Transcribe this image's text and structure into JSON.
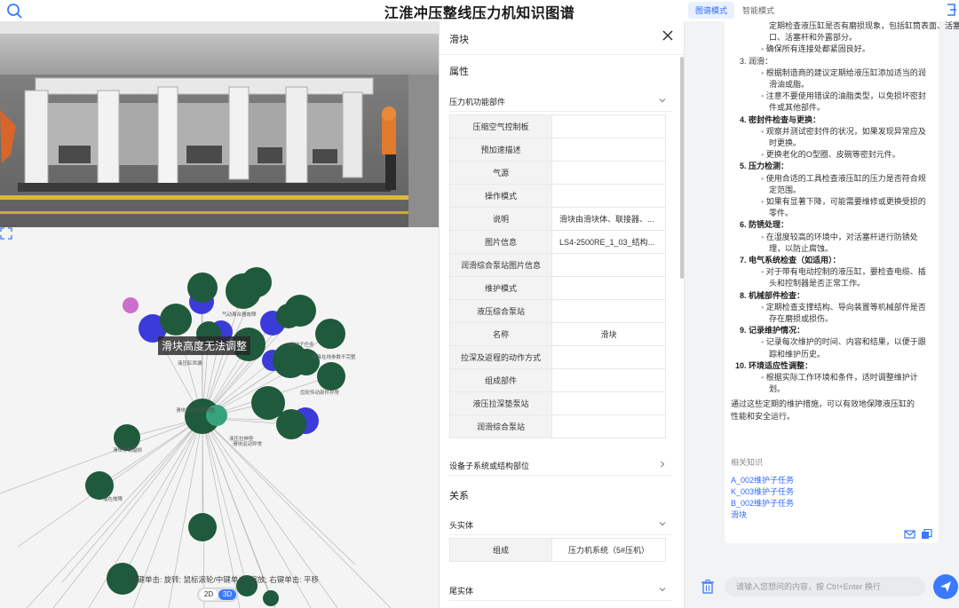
{
  "header": {
    "title": "江淮冲压整线压力机知识图谱",
    "modes": [
      "图谱模式",
      "智能模式"
    ]
  },
  "graph": {
    "tooltip": "滑块高度无法调整",
    "hint": "左键单击: 旋转; 鼠标滚轮/中键单击: 缩放; 右键单击: 平移",
    "view_toggle": [
      "2D",
      "3D"
    ],
    "node_labels": [
      "气动离合器故障",
      "滑块高度无法调整",
      "滑块运动异常",
      "液压缸泄漏",
      "维护子任务",
      "模具在线参数不完整",
      "齿轮传动部件异常",
      "液压拉伸垫",
      "滑块导轨磨损",
      "潜在故障"
    ]
  },
  "panel": {
    "title": "滑块",
    "attributes_title": "属性",
    "group_functional": "压力机功能部件",
    "rows": [
      {
        "k": "压缩空气控制板",
        "v": ""
      },
      {
        "k": "预加速描述",
        "v": ""
      },
      {
        "k": "气源",
        "v": ""
      },
      {
        "k": "操作模式",
        "v": ""
      },
      {
        "k": "说明",
        "v": "滑块由滑块体、联接器、..."
      },
      {
        "k": "图片信息",
        "v": "LS4-2500RE_1_03_结构..."
      },
      {
        "k": "润滑综合泵站图片信息",
        "v": ""
      },
      {
        "k": "维护模式",
        "v": ""
      },
      {
        "k": "液压综合泵站",
        "v": ""
      },
      {
        "k": "名称",
        "v": "滑块"
      },
      {
        "k": "拉深及返程的动作方式",
        "v": ""
      },
      {
        "k": "组成部件",
        "v": ""
      },
      {
        "k": "液压拉深垫泵站",
        "v": ""
      },
      {
        "k": "润滑综合泵站",
        "v": ""
      }
    ],
    "group_subsystem": "设备子系统或结构部位",
    "relations_title": "关系",
    "group_head": "头实体",
    "head_row": {
      "k": "组成",
      "v": "压力机系统（5#压机）"
    },
    "group_tail": "尾实体"
  },
  "chat": {
    "lines": [
      {
        "t": "定期检查液压缸是否有磨损现象，包括缸筒表面、活塞",
        "cls": "",
        "x": 50
      },
      {
        "t": "口、活塞杆和外露部分。",
        "cls": "",
        "x": 50
      },
      {
        "t": "◦ 确保所有连接处都紧固良好。",
        "cls": "",
        "x": 41
      },
      {
        "t": "3. 润滑：",
        "cls": "",
        "x": 17
      },
      {
        "t": "◦ 根据制造商的建议定期给液压缸添加适当的润",
        "cls": "",
        "x": 41
      },
      {
        "t": "滑油或脂。",
        "cls": "",
        "x": 50
      },
      {
        "t": "◦ 注意不要使用错误的油脂类型，以免损坏密封",
        "cls": "",
        "x": 41
      },
      {
        "t": "件或其他部件。",
        "cls": "",
        "x": 50
      },
      {
        "t": "4. 密封件检查与更换：",
        "cls": "b",
        "x": 17
      },
      {
        "t": "◦ 观察并测试密封件的状况，如果发现异常应及",
        "cls": "",
        "x": 41
      },
      {
        "t": "时更换。",
        "cls": "",
        "x": 50
      },
      {
        "t": "◦ 更换老化的O型圈、皮碗等密封元件。",
        "cls": "",
        "x": 41
      },
      {
        "t": "5. 压力检测：",
        "cls": "b",
        "x": 17
      },
      {
        "t": "◦ 使用合适的工具检查液压缸的压力是否符合规",
        "cls": "",
        "x": 41
      },
      {
        "t": "定范围。",
        "cls": "",
        "x": 50
      },
      {
        "t": "◦ 如果有显著下降，可能需要维修或更换受损的",
        "cls": "",
        "x": 41
      },
      {
        "t": "零件。",
        "cls": "",
        "x": 50
      },
      {
        "t": "6. 防锈处理：",
        "cls": "b",
        "x": 17
      },
      {
        "t": "◦ 在湿度较高的环境中，对活塞杆进行防锈处",
        "cls": "",
        "x": 41
      },
      {
        "t": "理，以防止腐蚀。",
        "cls": "",
        "x": 50
      },
      {
        "t": "7. 电气系统检查（如适用）：",
        "cls": "b",
        "x": 17
      },
      {
        "t": "◦ 对于带有电动控制的液压缸，要检查电缆、插",
        "cls": "",
        "x": 41
      },
      {
        "t": "头和控制器是否正常工作。",
        "cls": "",
        "x": 50
      },
      {
        "t": "8. 机械部件检查：",
        "cls": "b",
        "x": 17
      },
      {
        "t": "◦ 定期检查支撑结构、导向装置等机械部件是否",
        "cls": "",
        "x": 41
      },
      {
        "t": "存在磨损或损伤。",
        "cls": "",
        "x": 50
      },
      {
        "t": "9. 记录维护情况：",
        "cls": "b",
        "x": 17
      },
      {
        "t": "◦ 记录每次维护的时间、内容和结果，以便于跟",
        "cls": "",
        "x": 41
      },
      {
        "t": "踪和维护历史。",
        "cls": "",
        "x": 50
      },
      {
        "t": "10. 环境适应性调整：",
        "cls": "b",
        "x": 12
      },
      {
        "t": "◦ 根据实际工作环境和条件，适时调整维护计",
        "cls": "",
        "x": 41
      },
      {
        "t": "划。",
        "cls": "",
        "x": 50
      },
      {
        "t": "通过这些定期的维护措施，可以有效地保障液压缸的",
        "cls": "",
        "x": 7
      },
      {
        "t": "性能和安全运行。",
        "cls": "",
        "x": 7
      }
    ],
    "related_title": "相关知识",
    "related_links": [
      "A_002维护子任务",
      "K_003维护子任务",
      "B_002维护子任务",
      "滑块"
    ],
    "input_placeholder": "请输入您想问的内容，按 Ctrl+Enter 换行"
  }
}
